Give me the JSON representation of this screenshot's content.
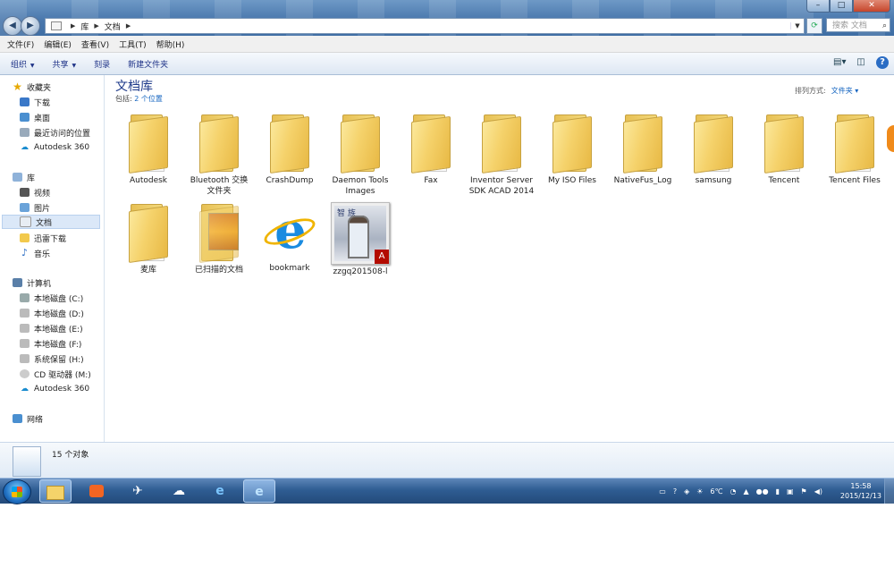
{
  "window": {
    "breadcrumb": [
      "库",
      "文档"
    ],
    "search_placeholder": "搜索 文档",
    "controls": {
      "min": "–",
      "max": "□",
      "close": "✕"
    }
  },
  "menu": [
    "文件(F)",
    "编辑(E)",
    "查看(V)",
    "工具(T)",
    "帮助(H)"
  ],
  "toolbar": {
    "organize": "组织",
    "share": "共享",
    "burn": "刻录",
    "new_folder": "新建文件夹"
  },
  "nav": {
    "favorites": {
      "label": "收藏夹",
      "items": [
        "下载",
        "桌面",
        "最近访问的位置",
        "Autodesk 360"
      ]
    },
    "libraries": {
      "label": "库",
      "items": [
        "视频",
        "图片",
        "文档",
        "迅雷下载",
        "音乐"
      ]
    },
    "computer": {
      "label": "计算机",
      "items": [
        "本地磁盘 (C:)",
        "本地磁盘 (D:)",
        "本地磁盘 (E:)",
        "本地磁盘 (F:)",
        "系统保留 (H:)",
        "CD 驱动器 (M:)",
        "Autodesk 360"
      ]
    },
    "network": {
      "label": "网络"
    }
  },
  "library": {
    "title": "文档库",
    "includes_prefix": "包括:",
    "includes_link": "2 个位置",
    "arrange_label": "排列方式:",
    "arrange_value": "文件夹"
  },
  "items": [
    "Autodesk",
    "Bluetooth 交换\n文件夹",
    "CrashDump",
    "Daemon Tools\nImages",
    "Fax",
    "Inventor Server\nSDK ACAD 2014",
    "My ISO Files",
    "NativeFus_Log",
    "samsung",
    "Tencent",
    "Tencent Files",
    "麦库",
    "已扫描的文档",
    "bookmark",
    "zzgq201508-l"
  ],
  "details": {
    "count": "15 个对象"
  },
  "taskbar": {
    "weather": "6℃",
    "time": "15:58",
    "date": "2015/12/13"
  },
  "icons": {
    "start": "windows-orb-icon",
    "explorer": "folder-icon",
    "media": "media-player-icon",
    "bird": "bird-app-icon",
    "cloud": "cloud-app-icon",
    "ie": "internet-explorer-icon"
  }
}
